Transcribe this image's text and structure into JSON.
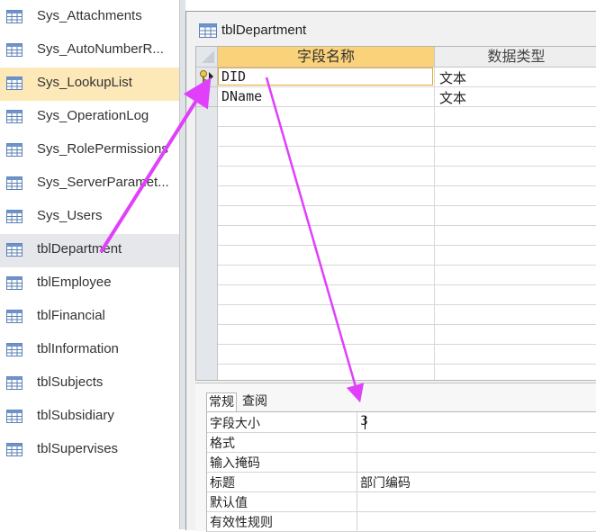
{
  "nav": {
    "items": [
      {
        "label": "Sys_Attachments"
      },
      {
        "label": "Sys_AutoNumberR..."
      },
      {
        "label": "Sys_LookupList"
      },
      {
        "label": "Sys_OperationLog"
      },
      {
        "label": "Sys_RolePermissions"
      },
      {
        "label": "Sys_ServerParamet..."
      },
      {
        "label": "Sys_Users"
      },
      {
        "label": "tblDepartment"
      },
      {
        "label": "tblEmployee"
      },
      {
        "label": "tblFinancial"
      },
      {
        "label": "tblInformation"
      },
      {
        "label": "tblSubjects"
      },
      {
        "label": "tblSubsidiary"
      },
      {
        "label": "tblSupervises"
      }
    ],
    "icon": "table-icon"
  },
  "document": {
    "title": "tblDepartment",
    "icon": "table-icon"
  },
  "design_grid": {
    "headers": {
      "field_name": "字段名称",
      "data_type": "数据类型"
    },
    "rows": [
      {
        "field_name": "DID",
        "data_type": "文本",
        "primary_key": true
      },
      {
        "field_name": "DName",
        "data_type": "文本",
        "primary_key": false
      }
    ]
  },
  "properties": {
    "tabs": {
      "general": "常规",
      "lookup": "查阅"
    },
    "active_tab": "常规",
    "rows": [
      {
        "label": "字段大小",
        "value": "3"
      },
      {
        "label": "格式",
        "value": ""
      },
      {
        "label": "输入掩码",
        "value": ""
      },
      {
        "label": "标题",
        "value": "部门编码"
      },
      {
        "label": "默认值",
        "value": ""
      },
      {
        "label": "有效性规则",
        "value": ""
      }
    ]
  },
  "colors": {
    "selected_nav": "#fde8b8",
    "hover_nav": "#e6e7eb",
    "header_highlight": "#f9d27a",
    "annotation_arrow": "#e040fb"
  }
}
